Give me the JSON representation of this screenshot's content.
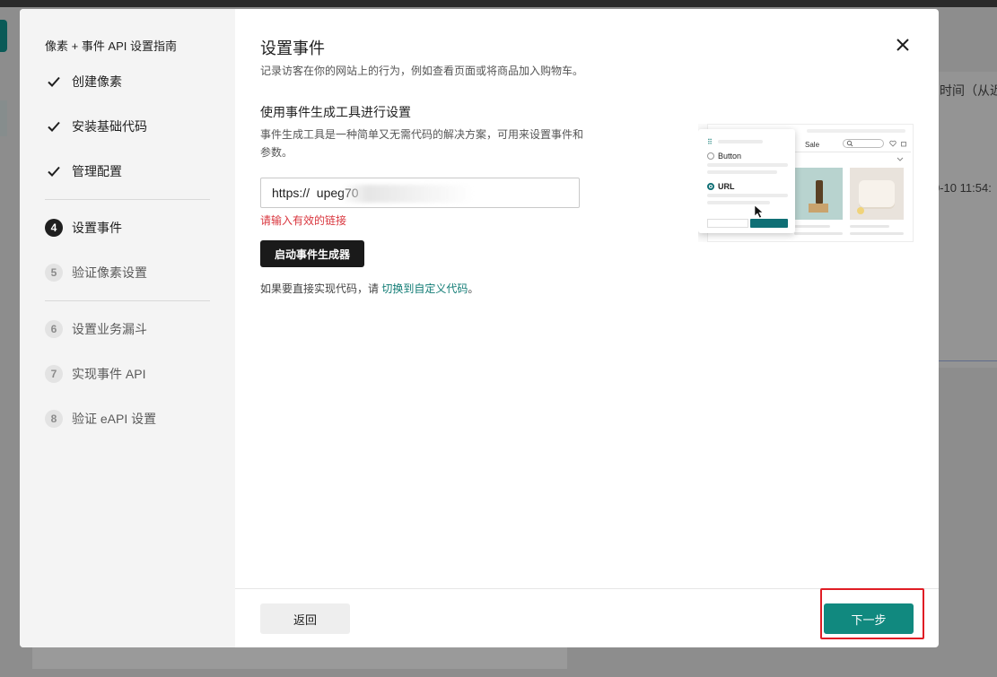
{
  "background": {
    "column_header": "时间（从近",
    "timestamp": "0-10 11:54:"
  },
  "modal": {
    "sidebar": {
      "title": "像素 + 事件 API 设置指南",
      "steps": [
        {
          "number": "1",
          "label": "创建像素",
          "status": "done"
        },
        {
          "number": "2",
          "label": "安装基础代码",
          "status": "done"
        },
        {
          "number": "3",
          "label": "管理配置",
          "status": "done"
        },
        {
          "number": "4",
          "label": "设置事件",
          "status": "active"
        },
        {
          "number": "5",
          "label": "验证像素设置",
          "status": "pending"
        },
        {
          "number": "6",
          "label": "设置业务漏斗",
          "status": "pending"
        },
        {
          "number": "7",
          "label": "实现事件 API",
          "status": "pending"
        },
        {
          "number": "8",
          "label": "验证 eAPI 设置",
          "status": "pending"
        }
      ]
    },
    "main": {
      "title": "设置事件",
      "description": "记录访客在你的网站上的行为，例如查看页面或将商品加入购物车。",
      "section_title": "使用事件生成工具进行设置",
      "section_description": "事件生成工具是一种简单又无需代码的解决方案，可用来设置事件和参数。",
      "url_input_value": "https://  upeg70",
      "error": "请输入有效的链接",
      "launch_button": "启动事件生成器",
      "hint_prefix": "如果要直接实现代码，请 ",
      "hint_link": "切换到自定义代码",
      "hint_suffix": "。",
      "illustration": {
        "store_label": "Sale",
        "option_button": "Button",
        "option_url": "URL",
        "selected_option": "URL"
      }
    },
    "footer": {
      "back_button": "返回",
      "next_button": "下一步"
    }
  },
  "colors": {
    "accent": "#11897f",
    "error": "#d9363e",
    "highlight": "#e01d25",
    "link": "#0f7b74"
  }
}
